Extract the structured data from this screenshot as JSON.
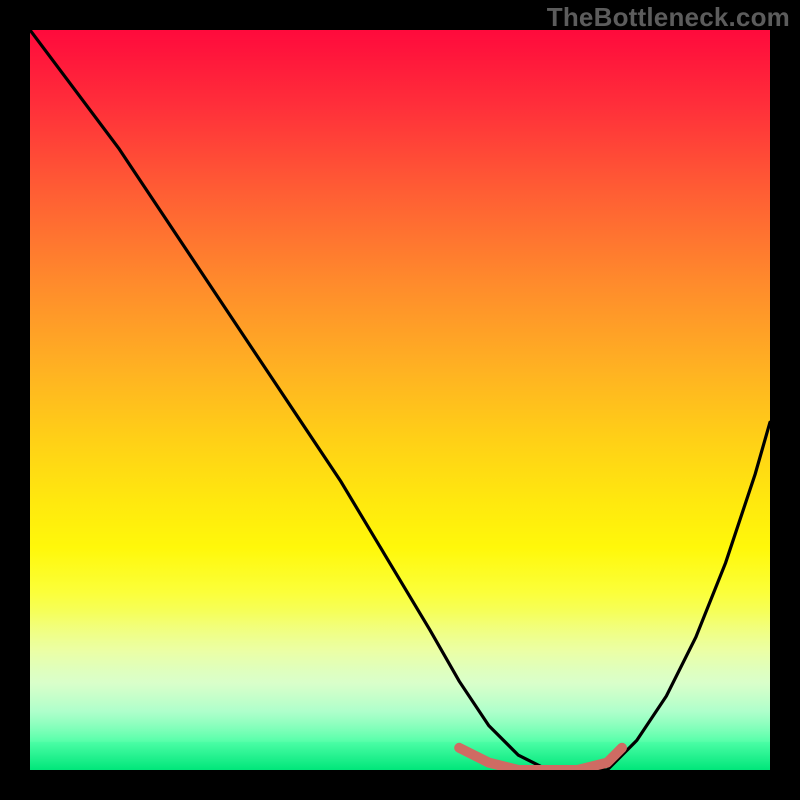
{
  "watermark": "TheBottleneck.com",
  "chart_data": {
    "type": "line",
    "title": "",
    "xlabel": "",
    "ylabel": "",
    "xlim": [
      0,
      100
    ],
    "ylim": [
      0,
      100
    ],
    "grid": false,
    "legend": false,
    "series": [
      {
        "name": "bottleneck-curve",
        "color": "#000000",
        "x": [
          0,
          6,
          12,
          18,
          24,
          30,
          36,
          42,
          48,
          54,
          58,
          62,
          66,
          70,
          74,
          78,
          82,
          86,
          90,
          94,
          98,
          100
        ],
        "values": [
          100,
          92,
          84,
          75,
          66,
          57,
          48,
          39,
          29,
          19,
          12,
          6,
          2,
          0,
          0,
          0,
          4,
          10,
          18,
          28,
          40,
          47
        ]
      },
      {
        "name": "optimal-zone-marker",
        "color": "#d06a63",
        "x": [
          58,
          62,
          66,
          70,
          74,
          78,
          80
        ],
        "values": [
          3,
          1,
          0,
          0,
          0,
          1,
          3
        ]
      }
    ],
    "gradient_stops": [
      {
        "pos": 0,
        "color": "#ff0a3c"
      },
      {
        "pos": 22,
        "color": "#ff5e34"
      },
      {
        "pos": 46,
        "color": "#ffb222"
      },
      {
        "pos": 64,
        "color": "#ffe90e"
      },
      {
        "pos": 84,
        "color": "#e4ff9a"
      },
      {
        "pos": 100,
        "color": "#00e67a"
      }
    ]
  }
}
